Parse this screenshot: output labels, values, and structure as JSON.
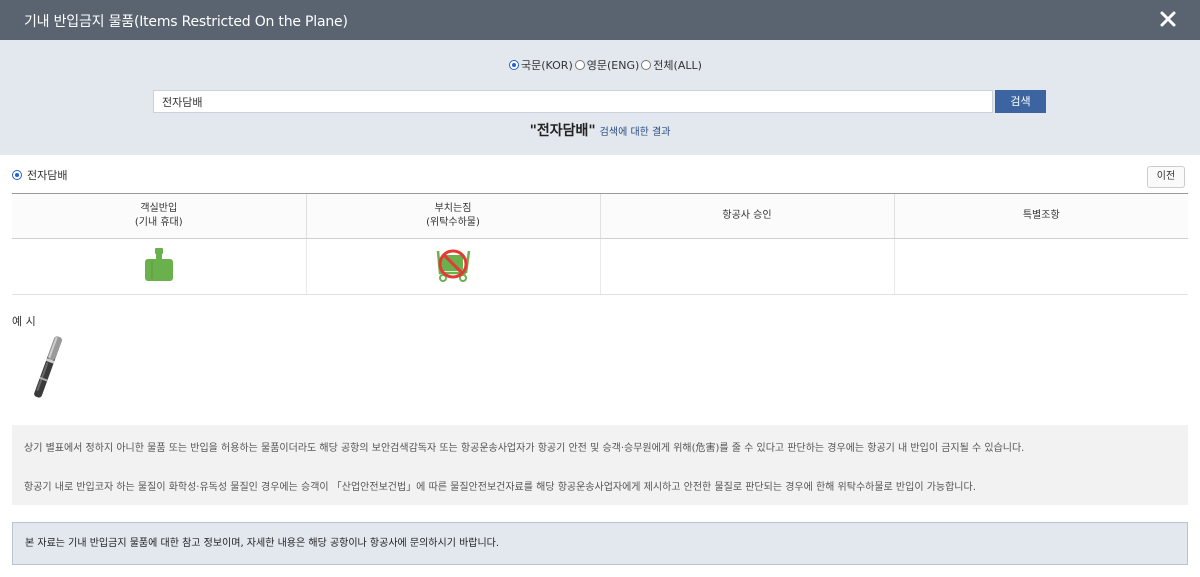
{
  "window": {
    "title": "기내 반입금지 물품(Items Restricted On the Plane)"
  },
  "search": {
    "language_options": [
      {
        "label": "국문(KOR)",
        "selected": true
      },
      {
        "label": "영문(ENG)",
        "selected": false
      },
      {
        "label": "전체(ALL)",
        "selected": false
      }
    ],
    "query_value": "전자담배",
    "button_label": "검색",
    "result_term": "\"전자담배\"",
    "result_suffix": "검색에 대한 결과"
  },
  "item": {
    "name": "전자담배",
    "prev_label": "이전",
    "columns": [
      {
        "line1": "객실반입",
        "line2": "(기내 휴대)"
      },
      {
        "line1": "부치는짐",
        "line2": "(위탁수하물)"
      },
      {
        "line1": "항공사 승인",
        "line2": ""
      },
      {
        "line1": "특별조항",
        "line2": ""
      }
    ],
    "cabin_status": {
      "icon": "carry-on-allowed-icon",
      "color": "#6ab04c"
    },
    "checked_status": {
      "icon": "checked-baggage-prohibited-icon",
      "color": "#6ab04c",
      "prohibit_color": "#e53935"
    }
  },
  "example": {
    "title": "예 시",
    "image_icon": "e-cigarette-pen-image"
  },
  "notes": [
    "상기 별표에서 정하지 아니한 물품 또는 반입을 허용하는 물품이더라도 해당 공항의 보안검색감독자 또는 항공운송사업자가 항공기 안전 및 승객·승무원에게 위해(危害)를 줄 수 있다고 판단하는 경우에는 항공기 내 반입이 금지될 수 있습니다.",
    "항공기 내로 반입코자 하는 물질이 화학성·유독성 물질인 경우에는 승객이 「산업안전보건법」에 따른 물질안전보건자료를 해당 항공운송사업자에게 제시하고 안전한 물질로 판단되는 경우에 한해 위탁수하물로 반입이 가능합니다."
  ],
  "notice": "본 자료는 기내 반입금지 물품에 대한 참고 정보이며, 자세한 내용은 해당 공항이나 항공사에 문의하시기 바랍니다."
}
